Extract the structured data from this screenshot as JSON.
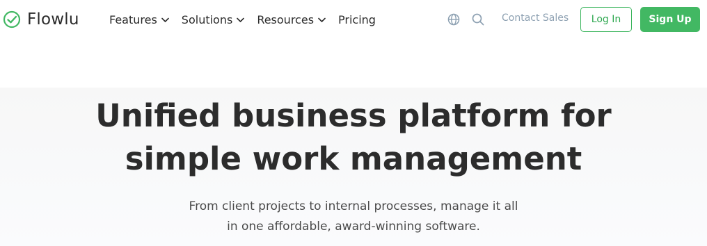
{
  "brand": {
    "name": "Flowlu",
    "accent": "#42b863"
  },
  "nav": {
    "items": [
      {
        "label": "Features",
        "has_dropdown": true
      },
      {
        "label": "Solutions",
        "has_dropdown": true
      },
      {
        "label": "Resources",
        "has_dropdown": true
      },
      {
        "label": "Pricing",
        "has_dropdown": false
      }
    ]
  },
  "header_actions": {
    "icons": [
      "globe-icon",
      "search-icon"
    ],
    "contact_label": "Contact Sales",
    "login_label": "Log In",
    "signup_label": "Sign Up"
  },
  "hero": {
    "headline_line1": "Unified business platform for",
    "headline_line2": "simple work management",
    "sub_line1": "From client projects to internal processes, manage it all",
    "sub_line2": "in one affordable, award-winning software."
  }
}
